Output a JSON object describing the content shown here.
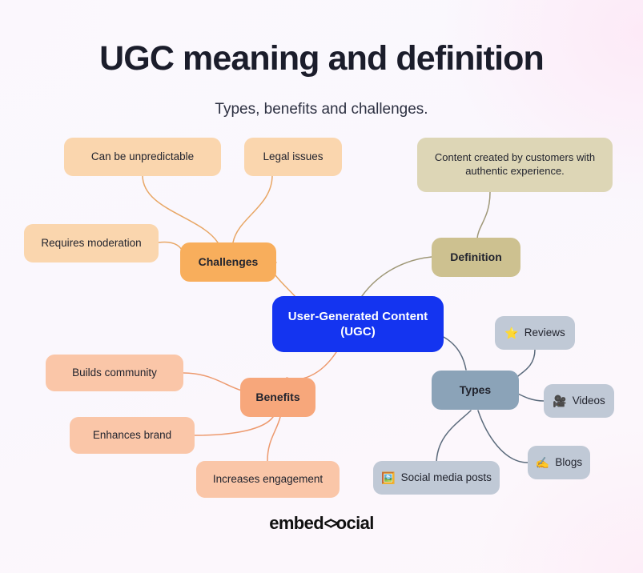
{
  "header": {
    "title": "UGC meaning and definition",
    "subtitle": "Types, benefits and challenges."
  },
  "footer": {
    "logo_prefix": "embed",
    "logo_mark": "<>",
    "logo_suffix": "ocial"
  },
  "colors": {
    "center": "#1434f0",
    "center_text": "#ffffff",
    "challenges_hub": "#f8ae5c",
    "challenges_leaf": "#fad6ae",
    "challenges_wire": "#e8a766",
    "definition_hub": "#cdc190",
    "definition_leaf": "#ddd6b6",
    "definition_wire": "#9f9878",
    "types_hub": "#8ba3b8",
    "types_leaf": "#c0c9d6",
    "types_wire": "#5b6b7c",
    "benefits_hub": "#f7a77b",
    "benefits_leaf": "#fac6a8",
    "benefits_wire": "#ed9a6e",
    "background": "#faf7fd",
    "title_text": "#1b1d2b"
  },
  "mindmap": {
    "type": "mindmap",
    "center": {
      "label": "User-Generated Content (UGC)",
      "line1": "User-Generated Content",
      "line2": "(UGC)"
    },
    "branches": [
      {
        "id": "challenges",
        "label": "Challenges",
        "leaves": [
          {
            "label": "Can be unpredictable",
            "icon": ""
          },
          {
            "label": "Legal issues",
            "icon": ""
          },
          {
            "label": "Requires moderation",
            "icon": ""
          }
        ]
      },
      {
        "id": "definition",
        "label": "Definition",
        "leaves": [
          {
            "label": "Content created by customers with authentic experience.",
            "icon": ""
          }
        ]
      },
      {
        "id": "types",
        "label": "Types",
        "leaves": [
          {
            "label": "Reviews",
            "icon": "⭐"
          },
          {
            "label": "Videos",
            "icon": "🎥"
          },
          {
            "label": "Blogs",
            "icon": "✍️"
          },
          {
            "label": "Social media posts",
            "icon": "🖼️"
          }
        ]
      },
      {
        "id": "benefits",
        "label": "Benefits",
        "leaves": [
          {
            "label": "Builds community",
            "icon": ""
          },
          {
            "label": "Enhances brand",
            "icon": ""
          },
          {
            "label": "Increases engagement",
            "icon": ""
          }
        ]
      }
    ]
  }
}
